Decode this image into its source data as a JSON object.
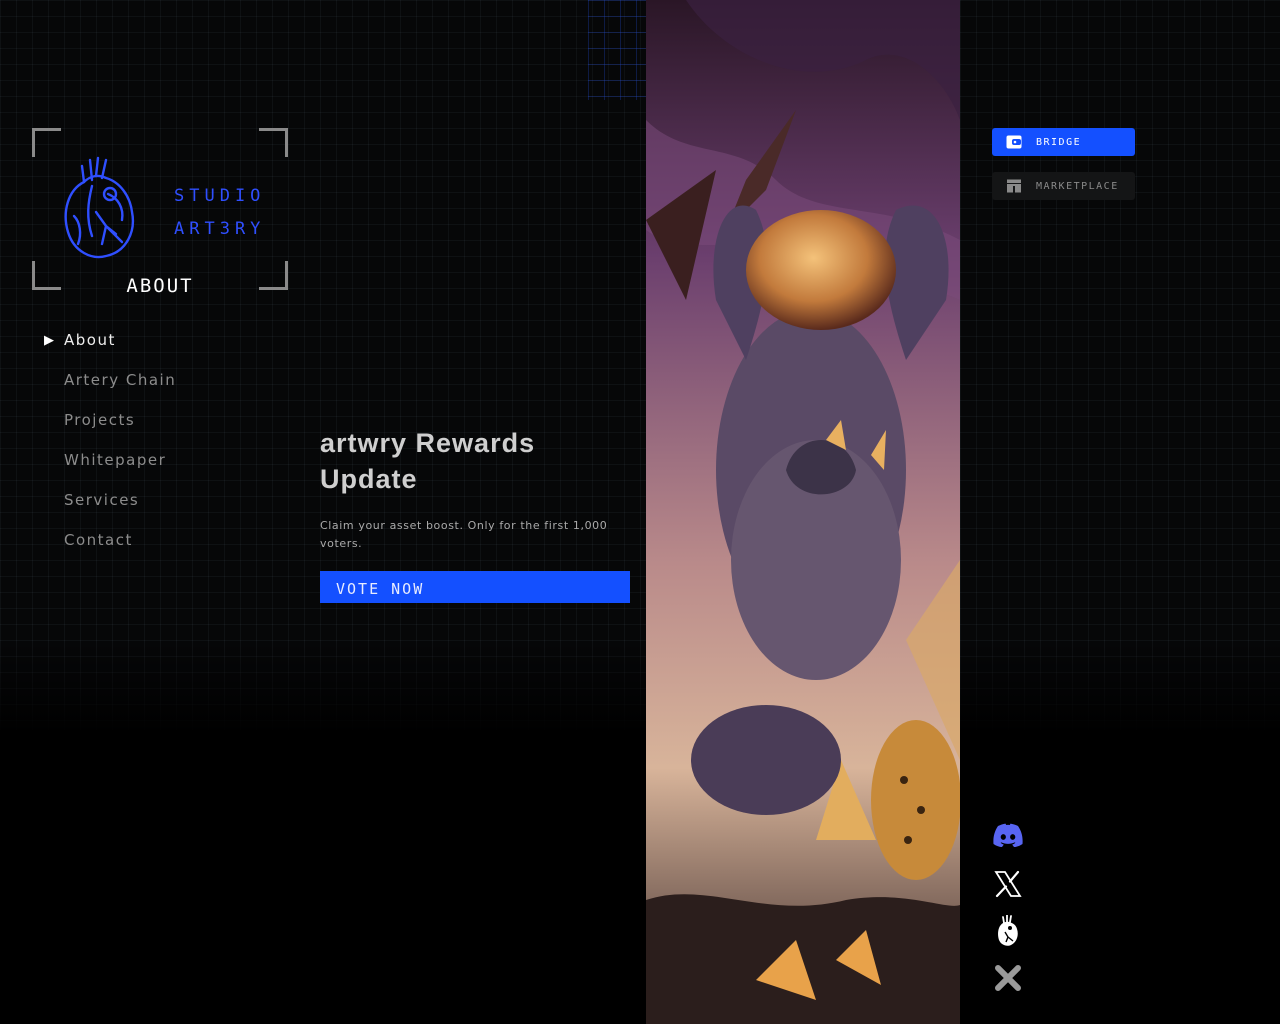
{
  "brand": {
    "line1": "STUDIO",
    "line2": "ART3RY",
    "accent_color": "#2f4fff",
    "logo_icon": "anatomical-heart-icon"
  },
  "page": {
    "title": "ABOUT"
  },
  "nav": {
    "items": [
      {
        "label": "About",
        "active": true
      },
      {
        "label": "Artery Chain",
        "active": false
      },
      {
        "label": "Projects",
        "active": false
      },
      {
        "label": "Whitepaper",
        "active": false
      },
      {
        "label": "Services",
        "active": false
      },
      {
        "label": "Contact",
        "active": false
      }
    ],
    "active_marker": "▶"
  },
  "promo": {
    "title": "artwry Rewards Update",
    "description": "Claim your asset boost. Only for the first 1,000 voters.",
    "button_label": "VOTE NOW",
    "button_color": "#1450ff"
  },
  "actions": {
    "bridge_label": "BRIDGE",
    "bridge_icon": "wallet-icon",
    "marketplace_label": "MARKETPLACE",
    "marketplace_icon": "shop-icon"
  },
  "social": [
    {
      "name": "discord-icon"
    },
    {
      "name": "x-icon"
    },
    {
      "name": "artery-heart-icon"
    },
    {
      "name": "cross-icon"
    }
  ]
}
